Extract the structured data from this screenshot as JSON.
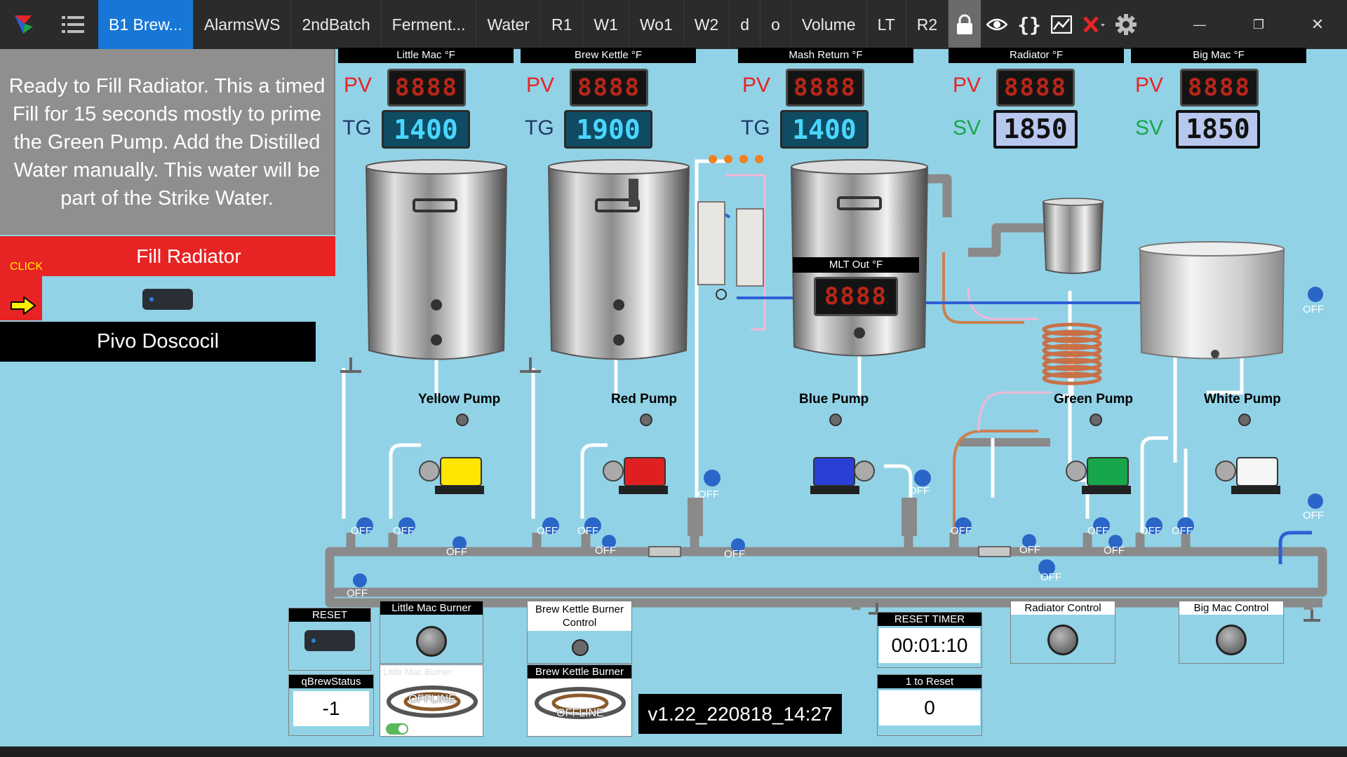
{
  "tabs": [
    "B1 Brew...",
    "AlarmsWS",
    "2ndBatch",
    "Ferment...",
    "Water",
    "R1",
    "W1",
    "Wo1",
    "W2",
    "d",
    "o",
    "Volume",
    "LT",
    "R2"
  ],
  "toolbar_icons": [
    "lock-icon",
    "eye-icon",
    "braces-icon",
    "chart-icon",
    "close-red-icon",
    "gear-icon"
  ],
  "window_controls": [
    "minimize-icon",
    "restore-icon",
    "close-icon"
  ],
  "left_panel": {
    "message": "Ready to Fill Radiator.  This a timed Fill for 15 seconds mostly to prime the Green Pump. Add the  Distilled Water manually. This water will be part of the Strike Water.",
    "click_label": "CLICK",
    "fill_button": "Fill Radiator",
    "status": "Pivo Doscocil"
  },
  "temps": [
    {
      "title": "Little Mac °F",
      "pv_label": "PV",
      "pv": "8888",
      "sp_label": "TG",
      "sp": "1400"
    },
    {
      "title": "Brew Kettle °F",
      "pv_label": "PV",
      "pv": "8888",
      "sp_label": "TG",
      "sp": "1900"
    },
    {
      "title": "Mash Return °F",
      "pv_label": "PV",
      "pv": "8888",
      "sp_label": "TG",
      "sp": "1400"
    },
    {
      "title": "Radiator °F",
      "pv_label": "PV",
      "pv": "8888",
      "sp_label": "SV",
      "sp": "1850"
    },
    {
      "title": "Big Mac °F",
      "pv_label": "PV",
      "pv": "8888",
      "sp_label": "SV",
      "sp": "1850"
    }
  ],
  "mlt_out": {
    "title": "MLT Out  °F",
    "value": "8888"
  },
  "pumps": [
    "Yellow Pump",
    "Red Pump",
    "Blue Pump",
    "Green Pump",
    "White Pump"
  ],
  "valve_state": "OFF",
  "controls": {
    "reset": "RESET",
    "little_mac_burner": "Little Mac Burner",
    "little_mac_burner_img": "Little Mac Burner",
    "brew_kettle_burner_control": "Brew Kettle Burner Control",
    "brew_kettle_burner": "Brew Kettle Burner",
    "offline": "OFFLINE",
    "qbrew_title": "qBrewStatus",
    "qbrew_value": "-1",
    "reset_timer": "RESET TIMER",
    "timer": "00:01:10",
    "one_to_reset": "1 to Reset",
    "one_to_reset_value": "0",
    "radiator_control": "Radiator Control",
    "big_mac_control": "Big Mac Control",
    "version": "v1.22_220818_14:27"
  },
  "colors": {
    "accent_tab": "#1777d6",
    "alert_red": "#e82323",
    "canvas_bg": "#92d2e6",
    "pipe_gray": "#8a8a8a",
    "pipe_white": "#ffffff",
    "pipe_blue": "#2f5fd6"
  }
}
